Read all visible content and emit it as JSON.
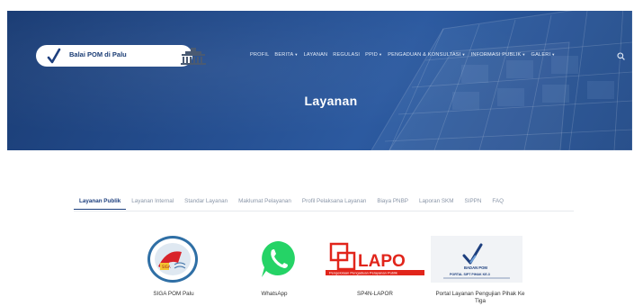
{
  "header": {
    "logo_text": "Balai POM di Palu",
    "nav": [
      {
        "label": "PROFIL",
        "has_caret": false
      },
      {
        "label": "BERITA",
        "has_caret": true
      },
      {
        "label": "LAYANAN",
        "has_caret": false
      },
      {
        "label": "REGULASI",
        "has_caret": false
      },
      {
        "label": "PPID",
        "has_caret": true
      },
      {
        "label": "PENGADUAN & KONSULTASI",
        "has_caret": true
      },
      {
        "label": "INFORMASI PUBLIK",
        "has_caret": true
      },
      {
        "label": "GALERI",
        "has_caret": true
      }
    ],
    "search_icon": "search-icon"
  },
  "hero": {
    "title": "Layanan"
  },
  "tabs": [
    {
      "label": "Layanan Publik",
      "active": true
    },
    {
      "label": "Layanan Internal",
      "active": false
    },
    {
      "label": "Standar Layanan",
      "active": false
    },
    {
      "label": "Maklumat Pelayanan",
      "active": false
    },
    {
      "label": "Profil Pelaksana Layanan",
      "active": false
    },
    {
      "label": "Biaya PNBP",
      "active": false
    },
    {
      "label": "Laporan SKM",
      "active": false
    },
    {
      "label": "SIPPN",
      "active": false
    },
    {
      "label": "FAQ",
      "active": false
    }
  ],
  "services": [
    {
      "label": "SIGA POM Palu"
    },
    {
      "label": "WhatsApp"
    },
    {
      "label": "SP4N-LAPOR",
      "logo_text": "LAPO",
      "logo_subtext": "Pengelolaan Pengaduan Pelayanan Publik"
    },
    {
      "label": "Portal Layanan Pengujian Pihak Ke Tiga",
      "logo_text": "BADAN POM",
      "logo_subtext": "PORTAL SIPT PIHAK KE-3"
    }
  ],
  "colors": {
    "brand_navy": "#1d3f7e",
    "hero_blue": "#244d8e",
    "whatsapp_green": "#25d366",
    "lapor_red": "#e1251b"
  }
}
